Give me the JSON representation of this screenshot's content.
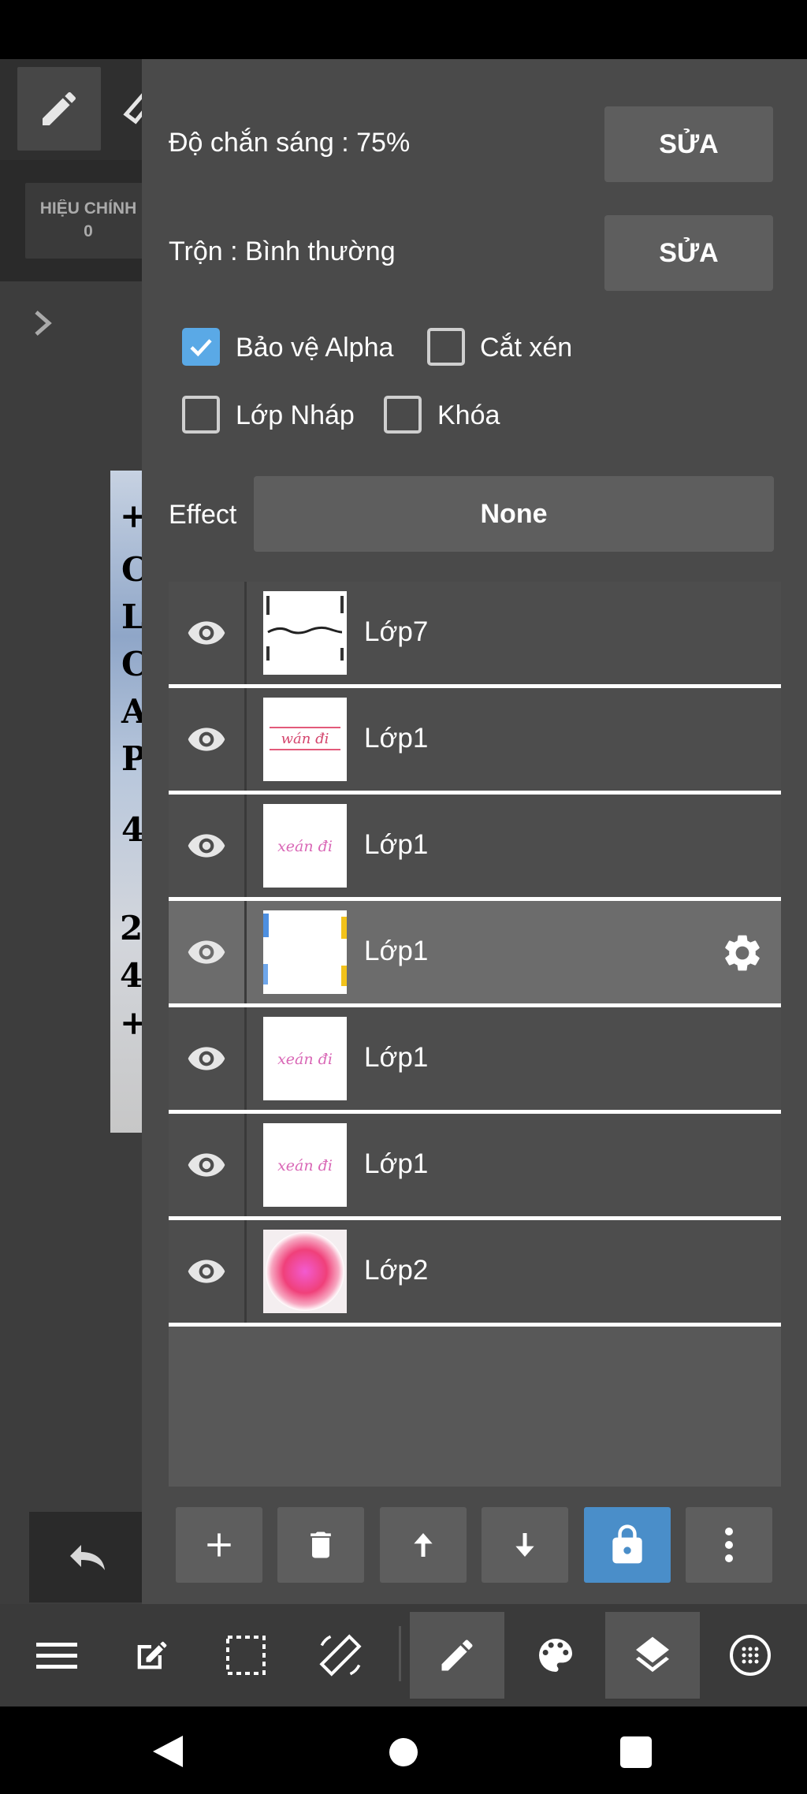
{
  "left": {
    "correction_label": "HIỆU CHỈNH",
    "correction_value": "0"
  },
  "panel": {
    "opacity_label": "Độ chắn sáng : 75%",
    "opacity_edit": "SỬA",
    "blend_label": "Trộn : Bình thường",
    "blend_edit": "SỬA",
    "checkboxes": [
      {
        "label": "Bảo vệ Alpha",
        "checked": true
      },
      {
        "label": "Cắt xén",
        "checked": false
      },
      {
        "label": "Lớp Nháp",
        "checked": false
      },
      {
        "label": "Khóa",
        "checked": false
      }
    ],
    "effect_label": "Effect",
    "effect_value": "None"
  },
  "layers": [
    {
      "name": "Lớp7",
      "visible": true,
      "selected": false,
      "thumb": "white-border-text"
    },
    {
      "name": "Lớp1",
      "visible": true,
      "selected": false,
      "thumb": "pink-title-red"
    },
    {
      "name": "Lớp1",
      "visible": true,
      "selected": false,
      "thumb": "pink-script"
    },
    {
      "name": "Lớp1",
      "visible": true,
      "selected": true,
      "thumb": "blue-yellow-edges"
    },
    {
      "name": "Lớp1",
      "visible": true,
      "selected": false,
      "thumb": "pink-script"
    },
    {
      "name": "Lớp1",
      "visible": true,
      "selected": false,
      "thumb": "pink-script"
    },
    {
      "name": "Lớp2",
      "visible": true,
      "selected": false,
      "thumb": "pink-blob"
    }
  ],
  "thumb_text": {
    "pink_title": "wán đi",
    "pink_script": "xeán đi"
  },
  "colors": {
    "accent": "#5aa9e6",
    "lock_button": "#4a8ec9",
    "panel_bg": "#4a4a4a",
    "button_bg": "#5e5e5e"
  }
}
